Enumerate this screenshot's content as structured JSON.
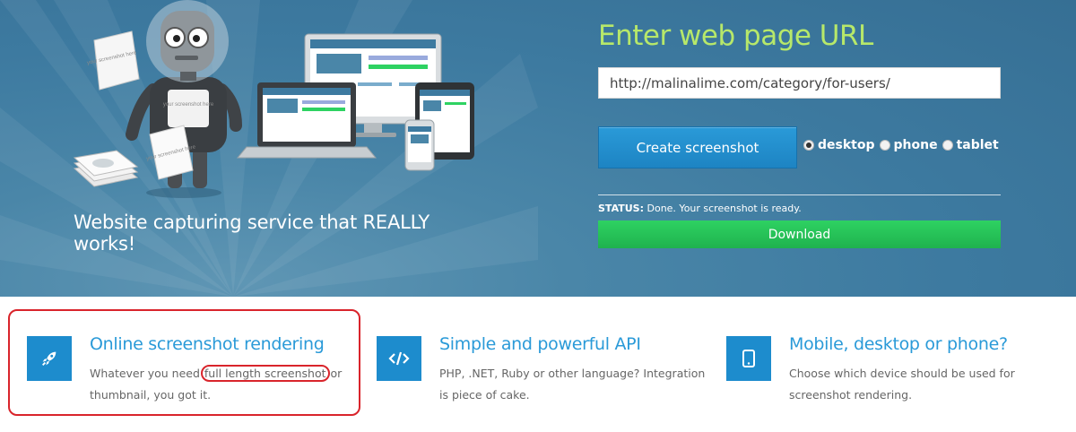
{
  "hero": {
    "tagline": "Website capturing service that REALLY works!",
    "illustration_labels": {
      "paper_left": "your screenshot here",
      "paper_robot": "your screenshot here",
      "paper_tilted": "your screenshot here"
    }
  },
  "form": {
    "title": "Enter web page URL",
    "url_value": "http://malinalime.com/category/for-users/",
    "create_button_label": "Create screenshot",
    "device_options": [
      {
        "label": "desktop",
        "selected": true
      },
      {
        "label": "phone",
        "selected": false
      },
      {
        "label": "tablet",
        "selected": false
      }
    ],
    "status_label": "STATUS:",
    "status_text": " Done. Your screenshot is ready.",
    "download_button_label": "Download"
  },
  "features": [
    {
      "icon": "rocket-icon",
      "title": "Online screenshot rendering",
      "desc_before": "Whatever you need ",
      "desc_highlight": "full length screenshot",
      "desc_after": " or thumbnail, you got it."
    },
    {
      "icon": "code-icon",
      "title": "Simple and powerful API",
      "desc": "PHP, .NET, Ruby or other language? Integration is piece of cake."
    },
    {
      "icon": "mobile-icon",
      "title": "Mobile, desktop or phone?",
      "desc": "Choose which device should be used for screenshot rendering."
    }
  ],
  "colors": {
    "hero_bg": "#3d7aa0",
    "title_green": "#b7e86a",
    "primary_blue": "#1d8ccd",
    "download_green": "#1fb24e",
    "annotation_red": "#d9242b"
  }
}
